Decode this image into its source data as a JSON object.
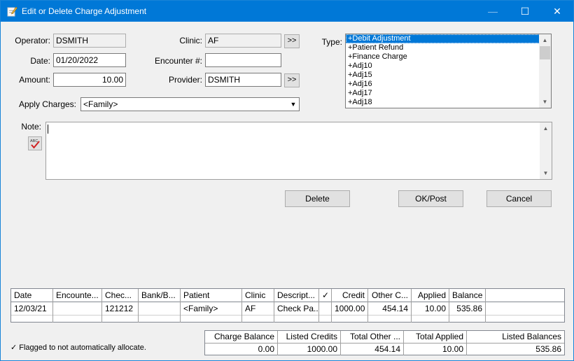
{
  "window": {
    "title": "Edit or Delete Charge Adjustment",
    "minimize_glyph": "—",
    "maximize_glyph": "☐",
    "close_glyph": "✕"
  },
  "form": {
    "operator_label": "Operator:",
    "operator_value": "DSMITH",
    "date_label": "Date:",
    "date_value": "01/20/2022",
    "amount_label": "Amount:",
    "amount_value": "10.00",
    "clinic_label": "Clinic:",
    "clinic_value": "AF",
    "encounter_label": "Encounter #:",
    "encounter_value": "",
    "provider_label": "Provider:",
    "provider_value": "DSMITH",
    "browse_label": ">>",
    "apply_label": "Apply Charges:",
    "apply_value": "<Family>",
    "type_label": "Type:",
    "type_items": [
      "+Debit Adjustment",
      "+Patient Refund",
      "+Finance Charge",
      "+Adj10",
      "+Adj15",
      "+Adj16",
      "+Adj17",
      "+Adj18"
    ],
    "note_label": "Note:",
    "note_value": ""
  },
  "buttons": {
    "delete": "Delete",
    "ok_post": "OK/Post",
    "cancel": "Cancel"
  },
  "grid": {
    "columns": [
      "Date",
      "Encounte...",
      "Chec...",
      "Bank/B...",
      "Patient",
      "Clinic",
      "Descript...",
      "✓",
      "Credit",
      "Other C...",
      "Applied",
      "Balance"
    ],
    "rows": [
      [
        "12/03/21",
        "",
        "121212",
        "",
        "<Family>",
        "AF",
        "Check Pa...",
        "",
        "1000.00",
        "454.14",
        "10.00",
        "535.86"
      ]
    ]
  },
  "totals": {
    "columns": [
      "Charge Balance",
      "Listed Credits",
      "Total Other ...",
      "Total Applied",
      "Listed Balances"
    ],
    "values": [
      "0.00",
      "1000.00",
      "454.14",
      "10.00",
      "535.86"
    ]
  },
  "footnote": "✓ Flagged to not automatically allocate.",
  "colors": {
    "titlebar": "#0078d7",
    "selection": "#0078d7"
  },
  "icons": {
    "title": "edit-note-icon",
    "spellcheck": "spellcheck-icon"
  }
}
